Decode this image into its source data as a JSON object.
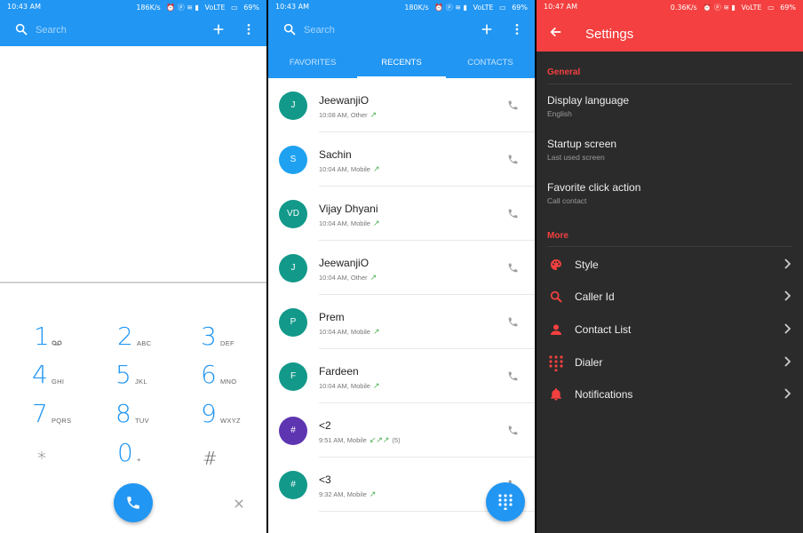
{
  "dialer": {
    "status": {
      "time": "10:43 AM",
      "speed": "186K/s",
      "carrier": "VoLTE",
      "battery": "69%"
    },
    "search_placeholder": "Search",
    "keys": [
      {
        "digit": "1",
        "letters": ""
      },
      {
        "digit": "2",
        "letters": "ABC"
      },
      {
        "digit": "3",
        "letters": "DEF"
      },
      {
        "digit": "4",
        "letters": "GHI"
      },
      {
        "digit": "5",
        "letters": "JKL"
      },
      {
        "digit": "6",
        "letters": "MNO"
      },
      {
        "digit": "7",
        "letters": "PQRS"
      },
      {
        "digit": "8",
        "letters": "TUV"
      },
      {
        "digit": "9",
        "letters": "WXYZ"
      },
      {
        "digit": "*",
        "letters": ""
      },
      {
        "digit": "0",
        "letters": "+"
      },
      {
        "digit": "#",
        "letters": ""
      }
    ],
    "accent": "#2196f3"
  },
  "recents": {
    "status": {
      "time": "10:43 AM",
      "speed": "180K/s",
      "carrier": "VoLTE",
      "battery": "69%"
    },
    "search_placeholder": "Search",
    "tabs": [
      "FAVORITES",
      "RECENTS",
      "CONTACTS"
    ],
    "active_tab": "RECENTS",
    "calls": [
      {
        "initials": "J",
        "name": "JeewanjiO",
        "detail": "10:08 AM, Other",
        "arrows": "↗",
        "count": "",
        "color": "#12998a"
      },
      {
        "initials": "S",
        "name": "Sachin",
        "detail": "10:04 AM, Mobile",
        "arrows": "↗",
        "count": "",
        "color": "#1ea1f0"
      },
      {
        "initials": "VD",
        "name": "Vijay Dhyani",
        "detail": "10:04 AM, Mobile",
        "arrows": "↗",
        "count": "",
        "color": "#12998a"
      },
      {
        "initials": "J",
        "name": "JeewanjiO",
        "detail": "10:04 AM, Other",
        "arrows": "↗",
        "count": "",
        "color": "#12998a"
      },
      {
        "initials": "P",
        "name": "Prem",
        "detail": "10:04 AM, Mobile",
        "arrows": "↗",
        "count": "",
        "color": "#12998a"
      },
      {
        "initials": "F",
        "name": "Fardeen",
        "detail": "10:04 AM, Mobile",
        "arrows": "↗",
        "count": "",
        "color": "#12998a"
      },
      {
        "initials": "#",
        "name": "<2",
        "detail": "9:51 AM, Mobile",
        "arrows": "↙↗↗",
        "count": "(5)",
        "color": "#5e35b1"
      },
      {
        "initials": "#",
        "name": "<3",
        "detail": "9:32 AM, Mobile",
        "arrows": "↗",
        "count": "",
        "color": "#12998a"
      }
    ]
  },
  "settings": {
    "status": {
      "time": "10:47 AM",
      "speed": "0.36K/s",
      "carrier": "VoLTE",
      "battery": "69%"
    },
    "title": "Settings",
    "general_header": "General",
    "general_items": [
      {
        "title": "Display language",
        "subtitle": "English"
      },
      {
        "title": "Startup screen",
        "subtitle": "Last used screen"
      },
      {
        "title": "Favorite click action",
        "subtitle": "Call contact"
      }
    ],
    "more_header": "More",
    "more_items": [
      {
        "label": "Style",
        "icon": "palette-icon"
      },
      {
        "label": "Caller Id",
        "icon": "search-icon"
      },
      {
        "label": "Contact List",
        "icon": "person-icon"
      },
      {
        "label": "Dialer",
        "icon": "dialpad-icon"
      },
      {
        "label": "Notifications",
        "icon": "bell-icon"
      }
    ],
    "accent": "#f44040"
  }
}
